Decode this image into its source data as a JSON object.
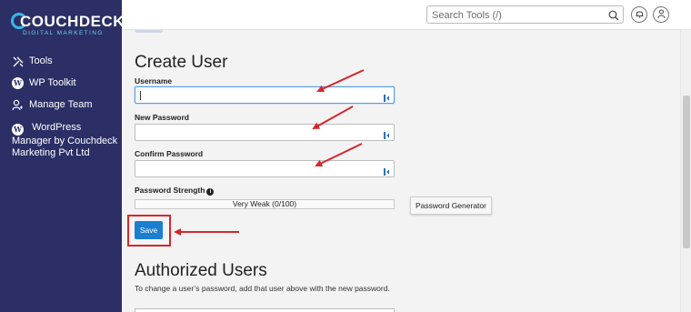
{
  "app": {
    "logo_main": "COUCHDECK",
    "logo_sub": "DIGITAL MARKETING"
  },
  "sidebar": {
    "items": [
      {
        "label": "Tools",
        "icon": "tools-icon"
      },
      {
        "label": "WP Toolkit",
        "icon": "wordpress-icon"
      },
      {
        "label": "Manage Team",
        "icon": "manage-team-icon"
      },
      {
        "label": "WordPress Manager by Couchdeck Marketing Pvt Ltd",
        "icon": "wordpress-icon"
      }
    ]
  },
  "header": {
    "search_placeholder": "Search Tools (/)"
  },
  "create_user": {
    "title": "Create User",
    "username_label": "Username",
    "username_value": "",
    "new_password_label": "New Password",
    "new_password_value": "",
    "confirm_password_label": "Confirm Password",
    "confirm_password_value": "",
    "strength_label": "Password Strength",
    "strength_text": "Very Weak (0/100)",
    "strength_value": 0,
    "password_generator_label": "Password Generator",
    "save_label": "Save"
  },
  "authorized_users": {
    "title": "Authorized Users",
    "description": "To change a user’s password, add that user above with the new password."
  },
  "colors": {
    "sidebar_bg": "#2b2f66",
    "accent": "#1b7ed1",
    "annotation": "#d6262c",
    "logo_accent": "#38b6e8"
  }
}
